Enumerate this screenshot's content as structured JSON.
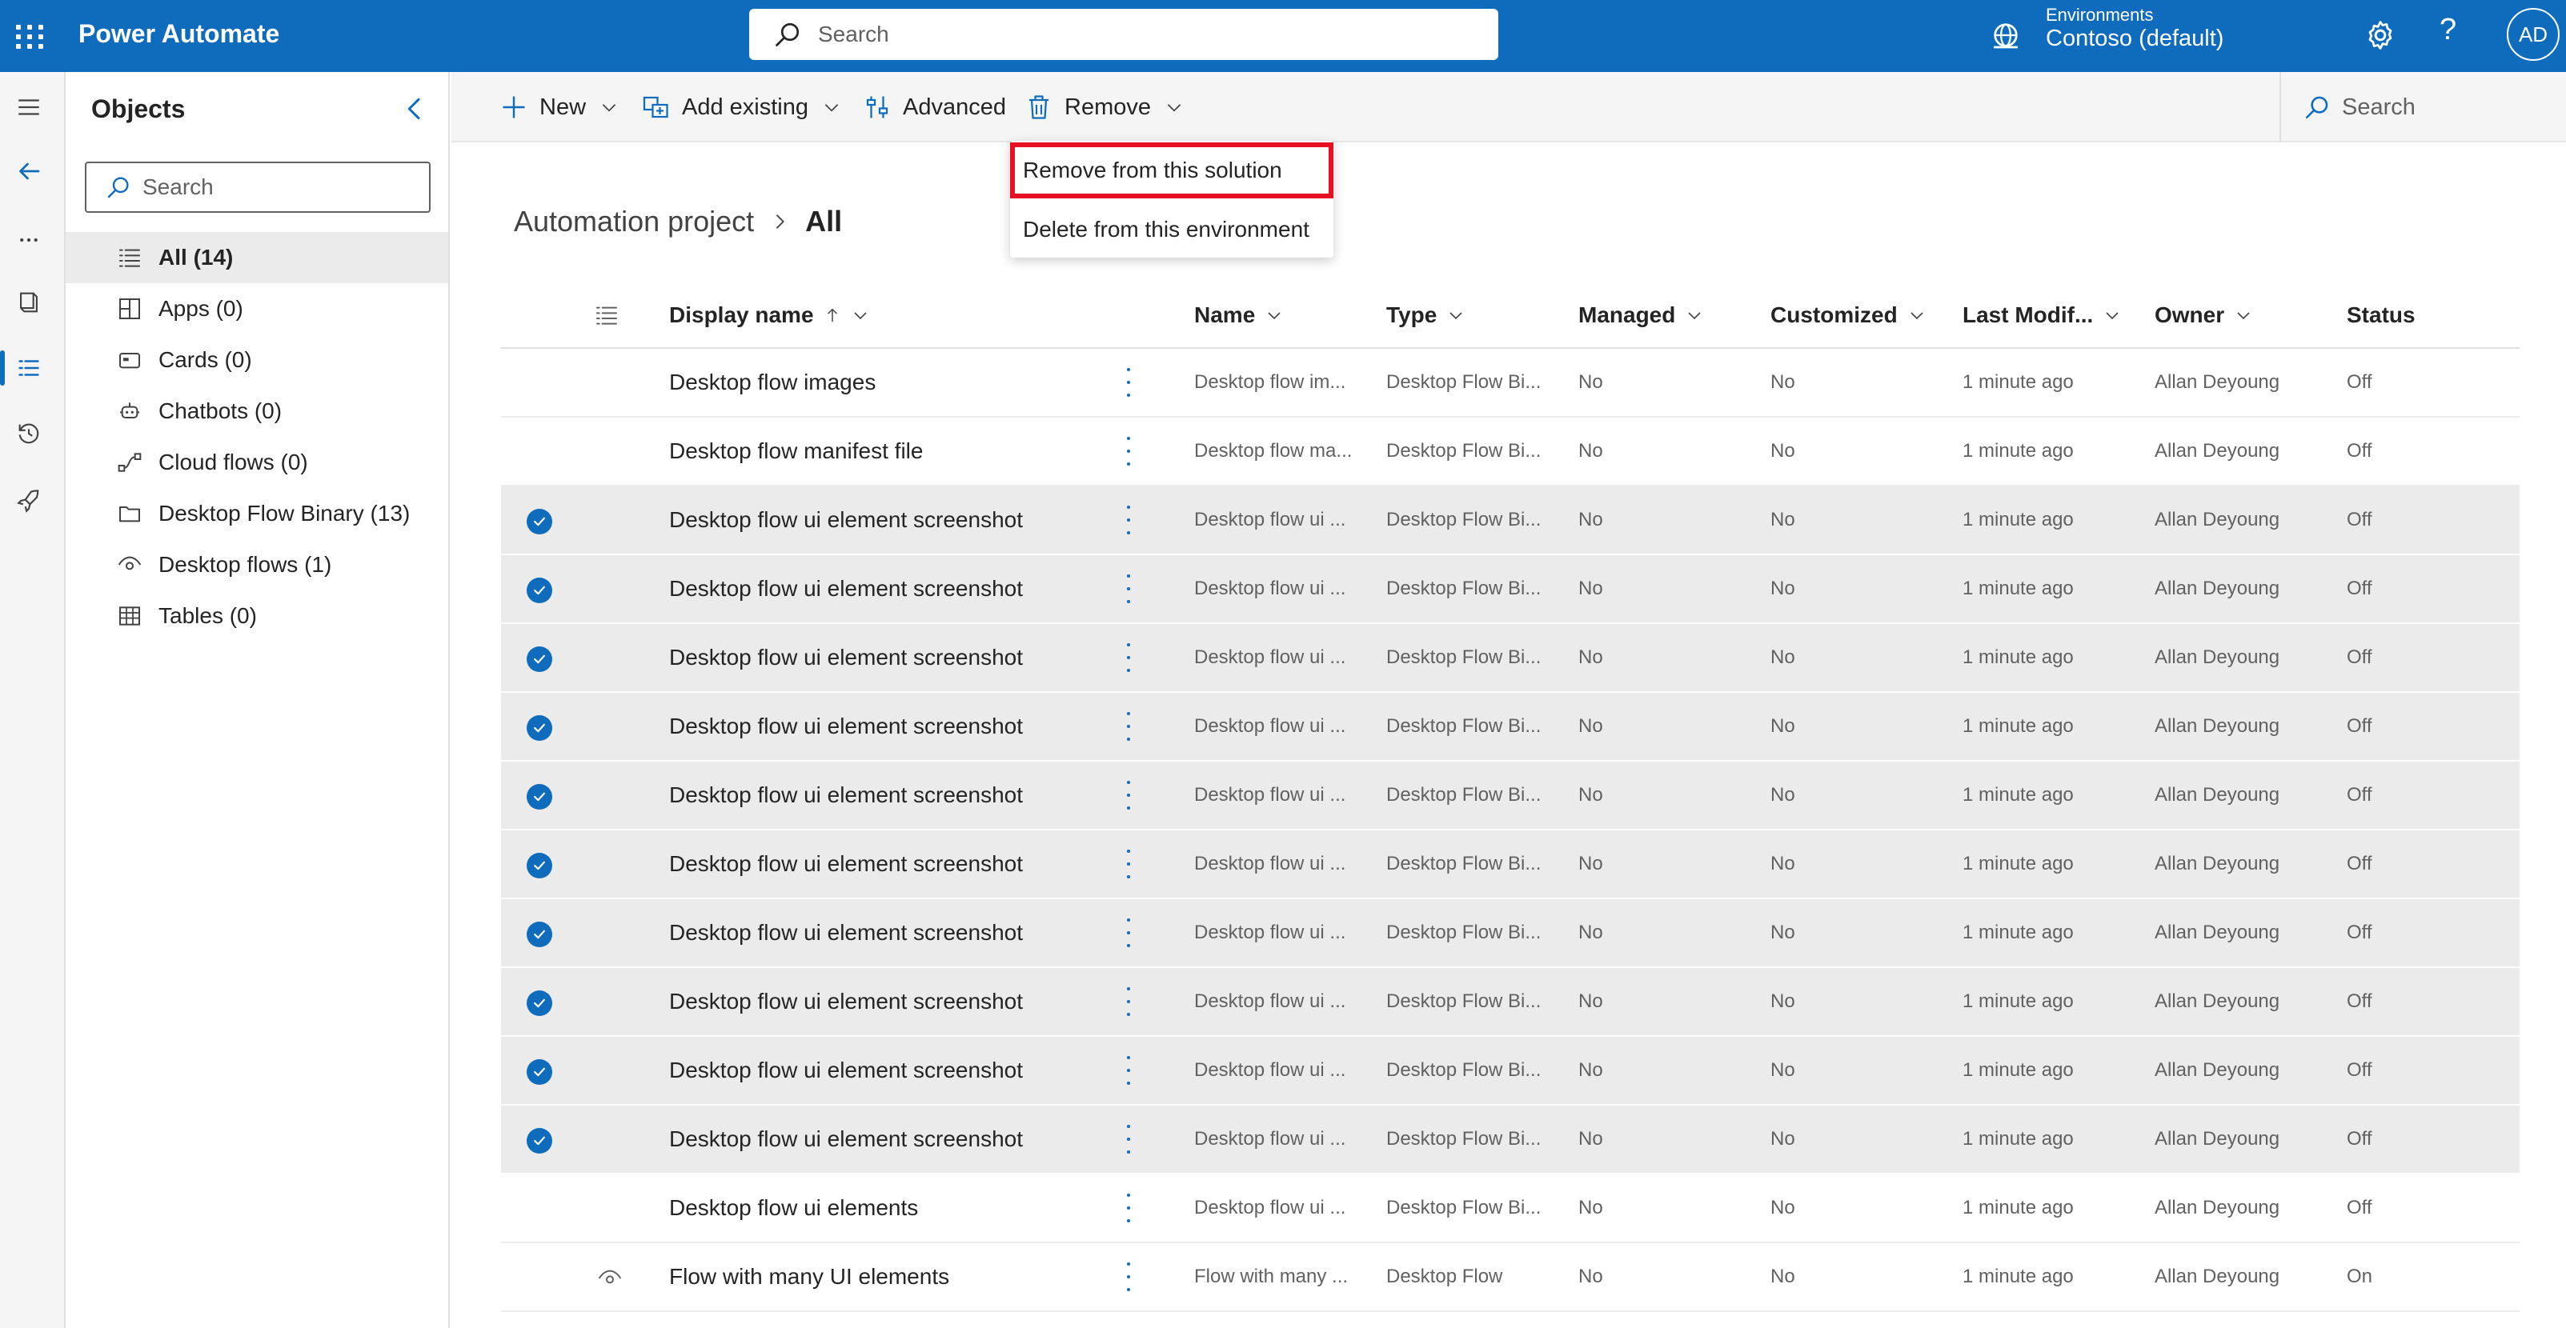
{
  "app": {
    "title": "Power Automate"
  },
  "top_search": {
    "placeholder": "Search"
  },
  "environment": {
    "label": "Environments",
    "name": "Contoso (default)"
  },
  "user": {
    "initials": "AD"
  },
  "objects_panel": {
    "title": "Objects",
    "search_placeholder": "Search",
    "items": [
      {
        "label": "All",
        "count": "(14)",
        "icon": "list-icon",
        "active": true
      },
      {
        "label": "Apps",
        "count": "(0)",
        "icon": "apps-icon",
        "active": false
      },
      {
        "label": "Cards",
        "count": "(0)",
        "icon": "card-icon",
        "active": false
      },
      {
        "label": "Chatbots",
        "count": "(0)",
        "icon": "bot-icon",
        "active": false
      },
      {
        "label": "Cloud flows",
        "count": "(0)",
        "icon": "flow-icon",
        "active": false
      },
      {
        "label": "Desktop Flow Binary",
        "count": "(13)",
        "icon": "folder-icon",
        "active": false
      },
      {
        "label": "Desktop flows",
        "count": "(1)",
        "icon": "eye-icon",
        "active": false
      },
      {
        "label": "Tables",
        "count": "(0)",
        "icon": "table-icon",
        "active": false
      }
    ]
  },
  "commands": {
    "new": "New",
    "add_existing": "Add existing",
    "advanced": "Advanced",
    "remove": "Remove",
    "search": "Search"
  },
  "remove_menu": {
    "remove_from_solution": "Remove from this solution",
    "delete_from_environment": "Delete from this environment"
  },
  "breadcrumb": {
    "parent": "Automation project",
    "current": "All"
  },
  "columns": {
    "display_name": "Display name",
    "name": "Name",
    "type": "Type",
    "managed": "Managed",
    "customized": "Customized",
    "last_modified": "Last Modif...",
    "owner": "Owner",
    "status": "Status"
  },
  "rows": [
    {
      "display_name": "Desktop flow images",
      "name": "Desktop flow im...",
      "type": "Desktop Flow Bi...",
      "managed": "No",
      "customized": "No",
      "last_modified": "1 minute ago",
      "owner": "Allan Deyoung",
      "status": "Off",
      "selected": false,
      "icon": ""
    },
    {
      "display_name": "Desktop flow manifest file",
      "name": "Desktop flow ma...",
      "type": "Desktop Flow Bi...",
      "managed": "No",
      "customized": "No",
      "last_modified": "1 minute ago",
      "owner": "Allan Deyoung",
      "status": "Off",
      "selected": false,
      "icon": ""
    },
    {
      "display_name": "Desktop flow ui element screenshot",
      "name": "Desktop flow ui ...",
      "type": "Desktop Flow Bi...",
      "managed": "No",
      "customized": "No",
      "last_modified": "1 minute ago",
      "owner": "Allan Deyoung",
      "status": "Off",
      "selected": true,
      "icon": ""
    },
    {
      "display_name": "Desktop flow ui element screenshot",
      "name": "Desktop flow ui ...",
      "type": "Desktop Flow Bi...",
      "managed": "No",
      "customized": "No",
      "last_modified": "1 minute ago",
      "owner": "Allan Deyoung",
      "status": "Off",
      "selected": true,
      "icon": ""
    },
    {
      "display_name": "Desktop flow ui element screenshot",
      "name": "Desktop flow ui ...",
      "type": "Desktop Flow Bi...",
      "managed": "No",
      "customized": "No",
      "last_modified": "1 minute ago",
      "owner": "Allan Deyoung",
      "status": "Off",
      "selected": true,
      "icon": ""
    },
    {
      "display_name": "Desktop flow ui element screenshot",
      "name": "Desktop flow ui ...",
      "type": "Desktop Flow Bi...",
      "managed": "No",
      "customized": "No",
      "last_modified": "1 minute ago",
      "owner": "Allan Deyoung",
      "status": "Off",
      "selected": true,
      "icon": ""
    },
    {
      "display_name": "Desktop flow ui element screenshot",
      "name": "Desktop flow ui ...",
      "type": "Desktop Flow Bi...",
      "managed": "No",
      "customized": "No",
      "last_modified": "1 minute ago",
      "owner": "Allan Deyoung",
      "status": "Off",
      "selected": true,
      "icon": ""
    },
    {
      "display_name": "Desktop flow ui element screenshot",
      "name": "Desktop flow ui ...",
      "type": "Desktop Flow Bi...",
      "managed": "No",
      "customized": "No",
      "last_modified": "1 minute ago",
      "owner": "Allan Deyoung",
      "status": "Off",
      "selected": true,
      "icon": ""
    },
    {
      "display_name": "Desktop flow ui element screenshot",
      "name": "Desktop flow ui ...",
      "type": "Desktop Flow Bi...",
      "managed": "No",
      "customized": "No",
      "last_modified": "1 minute ago",
      "owner": "Allan Deyoung",
      "status": "Off",
      "selected": true,
      "icon": ""
    },
    {
      "display_name": "Desktop flow ui element screenshot",
      "name": "Desktop flow ui ...",
      "type": "Desktop Flow Bi...",
      "managed": "No",
      "customized": "No",
      "last_modified": "1 minute ago",
      "owner": "Allan Deyoung",
      "status": "Off",
      "selected": true,
      "icon": ""
    },
    {
      "display_name": "Desktop flow ui element screenshot",
      "name": "Desktop flow ui ...",
      "type": "Desktop Flow Bi...",
      "managed": "No",
      "customized": "No",
      "last_modified": "1 minute ago",
      "owner": "Allan Deyoung",
      "status": "Off",
      "selected": true,
      "icon": ""
    },
    {
      "display_name": "Desktop flow ui element screenshot",
      "name": "Desktop flow ui ...",
      "type": "Desktop Flow Bi...",
      "managed": "No",
      "customized": "No",
      "last_modified": "1 minute ago",
      "owner": "Allan Deyoung",
      "status": "Off",
      "selected": true,
      "icon": ""
    },
    {
      "display_name": "Desktop flow ui elements",
      "name": "Desktop flow ui ...",
      "type": "Desktop Flow Bi...",
      "managed": "No",
      "customized": "No",
      "last_modified": "1 minute ago",
      "owner": "Allan Deyoung",
      "status": "Off",
      "selected": false,
      "icon": ""
    },
    {
      "display_name": "Flow with many UI elements",
      "name": "Flow with many ...",
      "type": "Desktop Flow",
      "managed": "No",
      "customized": "No",
      "last_modified": "1 minute ago",
      "owner": "Allan Deyoung",
      "status": "On",
      "selected": false,
      "icon": "eye-icon"
    }
  ],
  "colors": {
    "brand": "#0f6cbd",
    "highlight_border": "#e81123",
    "selected_row": "#ebebeb"
  }
}
